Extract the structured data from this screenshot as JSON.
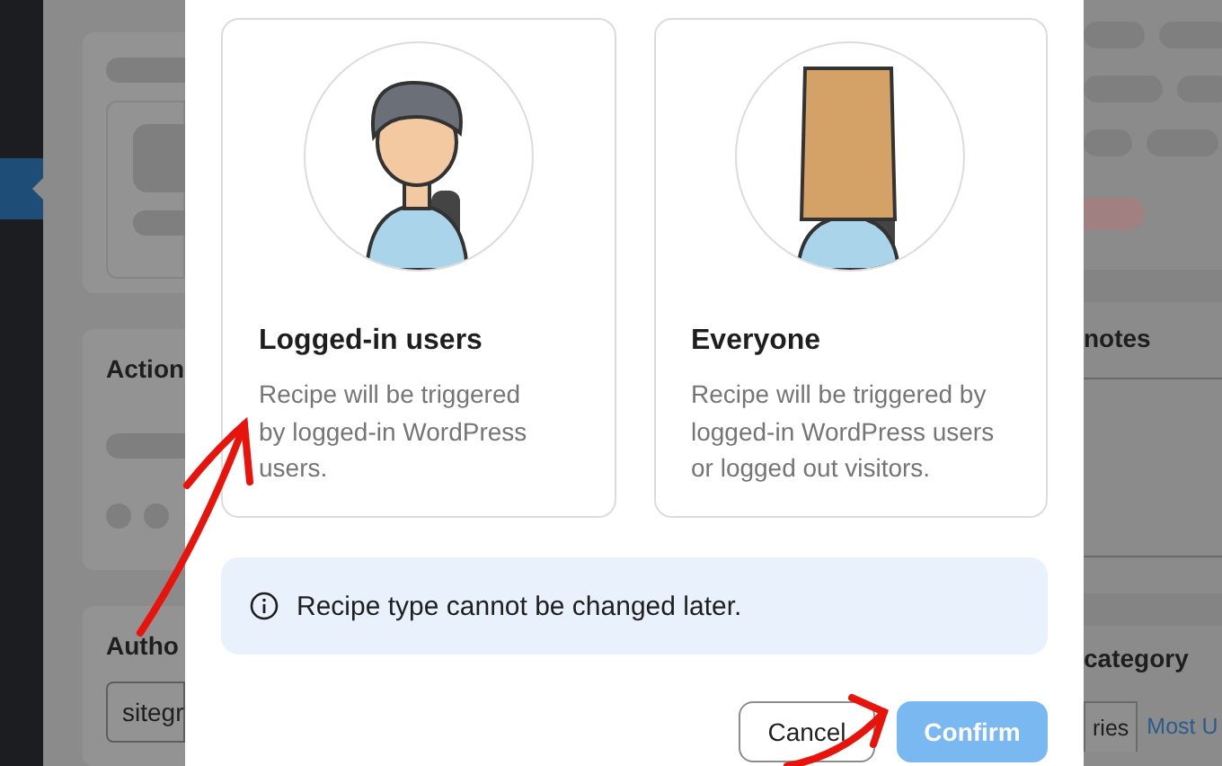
{
  "sidebar": {
    "active_item": {
      "selected": true
    }
  },
  "left_panels": [
    {
      "title": "Action"
    },
    {
      "title": "Autho",
      "field_value": "sitegr"
    }
  ],
  "modal": {
    "options": [
      {
        "kind": "logged_in",
        "title": "Logged-in users",
        "description": "Recipe will be triggered by logged-in WordPress users.",
        "selected": false
      },
      {
        "kind": "everyone",
        "title": "Everyone",
        "description": "Recipe will be triggered by logged-in WordPress users or logged out visitors.",
        "selected": false
      }
    ],
    "notice": "Recipe type cannot be changed later.",
    "buttons": [
      {
        "kind": "secondary",
        "label": "Cancel",
        "disabled": false
      },
      {
        "kind": "primary",
        "label": "Confirm",
        "disabled": true
      }
    ]
  },
  "right_panels": [
    {
      "title": "notes"
    },
    {
      "title": "category",
      "tabs": [
        {
          "label": "ries",
          "selected": true
        },
        {
          "label": "Most U",
          "selected": false
        }
      ]
    }
  ]
}
